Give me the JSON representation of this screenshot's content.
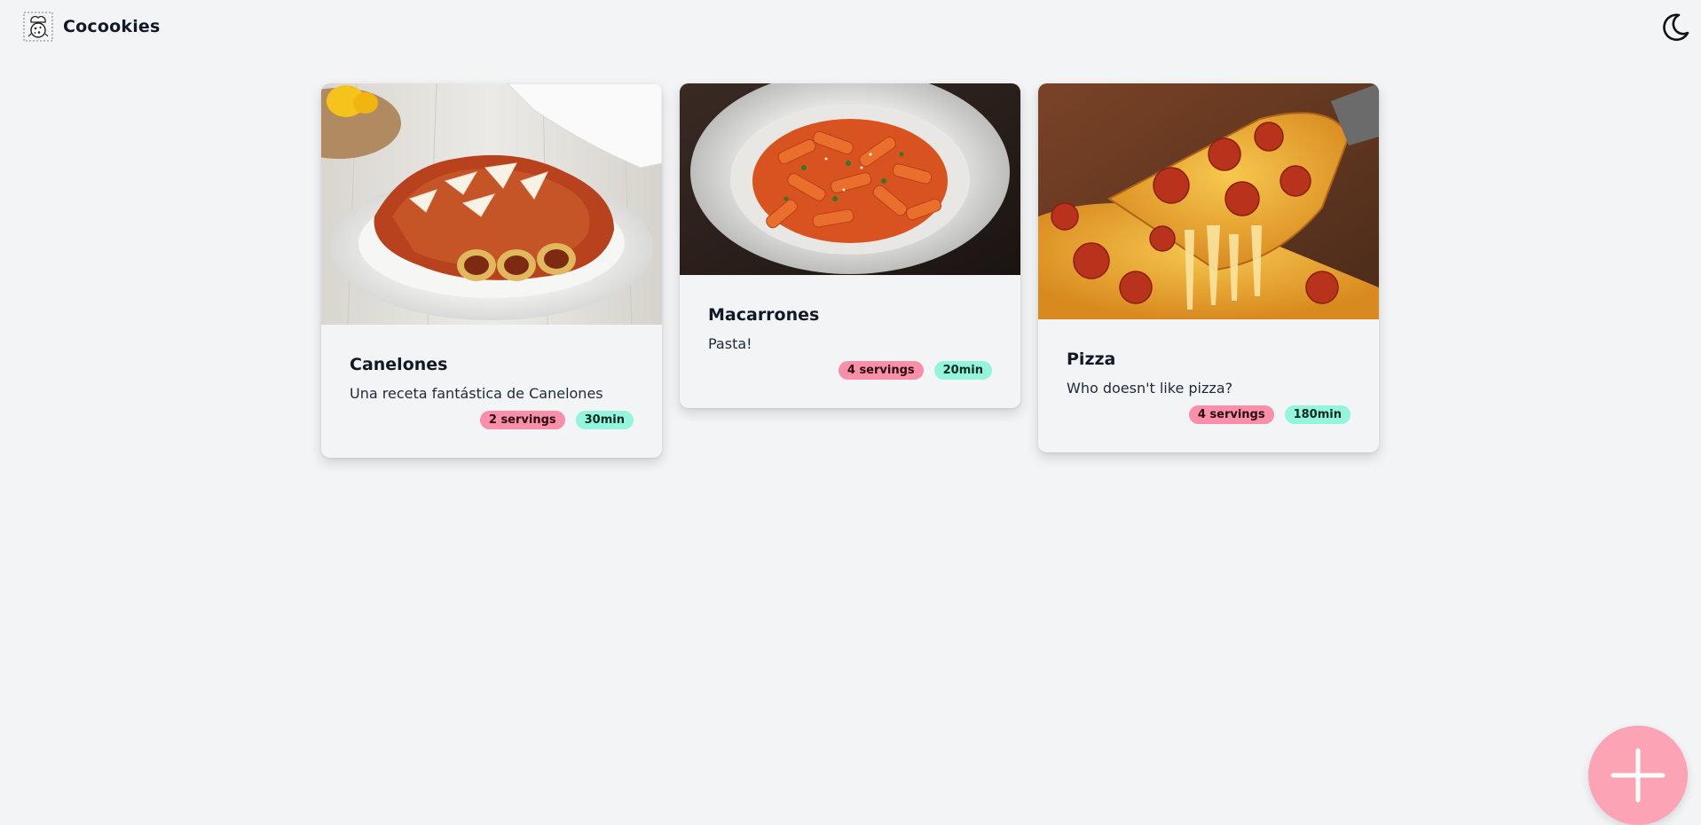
{
  "app": {
    "name": "Cocookies",
    "logo_icon": "cookie-chef-icon",
    "theme_icon": "moon-icon"
  },
  "recipes": [
    {
      "title": "Canelones",
      "description": "Una receta fantástica de Canelones",
      "servings": "2 servings",
      "time": "30min",
      "image": "cannelloni-plate-photo"
    },
    {
      "title": "Macarrones",
      "description": "Pasta!",
      "servings": "4 servings",
      "time": "20min",
      "image": "penne-pasta-bowl-photo"
    },
    {
      "title": "Pizza",
      "description": "Who doesn't like pizza?",
      "servings": "4 servings",
      "time": "180min",
      "image": "pepperoni-pizza-slice-photo"
    }
  ],
  "fab": {
    "icon": "plus-icon"
  },
  "colors": {
    "background": "#f3f4f6",
    "servings_badge": "#f98fa8",
    "time_badge": "#94f5dc",
    "fab": "#fca3b6"
  }
}
